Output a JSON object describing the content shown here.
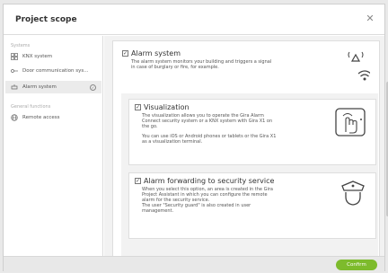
{
  "dialog": {
    "title": "Project scope",
    "close_icon": "close-icon"
  },
  "sidebar": {
    "systems_label": "Systems",
    "items": [
      {
        "label": "KNX system",
        "icon": "knx-grid-icon"
      },
      {
        "label": "Door communication sys...",
        "icon": "door-key-icon"
      },
      {
        "label": "Alarm system",
        "icon": "alarm-icon",
        "active": true
      }
    ],
    "general_label": "General functions",
    "general_items": [
      {
        "label": "Remote access",
        "icon": "globe-icon"
      }
    ]
  },
  "cards": {
    "alarm": {
      "title": "Alarm system",
      "checked": true,
      "desc1": "The alarm system monitors your building and triggers a signal",
      "desc2": "in case of burglary or fire, for example."
    },
    "visualization": {
      "title": "Visualization",
      "checked": true,
      "desc1": "The visualization allows you to operate the Gira Alarm",
      "desc2": "Connect security system or a KNX system with Gira X1 on",
      "desc3": "the go.",
      "desc4": "You can use iOS or Android phones or tablets or the Gira X1",
      "desc5": "as a visualization terminal."
    },
    "forwarding": {
      "title": "Alarm forwarding to security service",
      "checked": true,
      "desc1": "When you select this option, an area is created in the Gira",
      "desc2": "Project Assistant in which you can configure the remote",
      "desc3": "alarm for the security service.",
      "desc4": "The user \"Security guard\" is also created in user",
      "desc5": "management."
    }
  },
  "footer": {
    "confirm_label": "Confirm"
  },
  "colors": {
    "accent": "#7dbb2c"
  }
}
